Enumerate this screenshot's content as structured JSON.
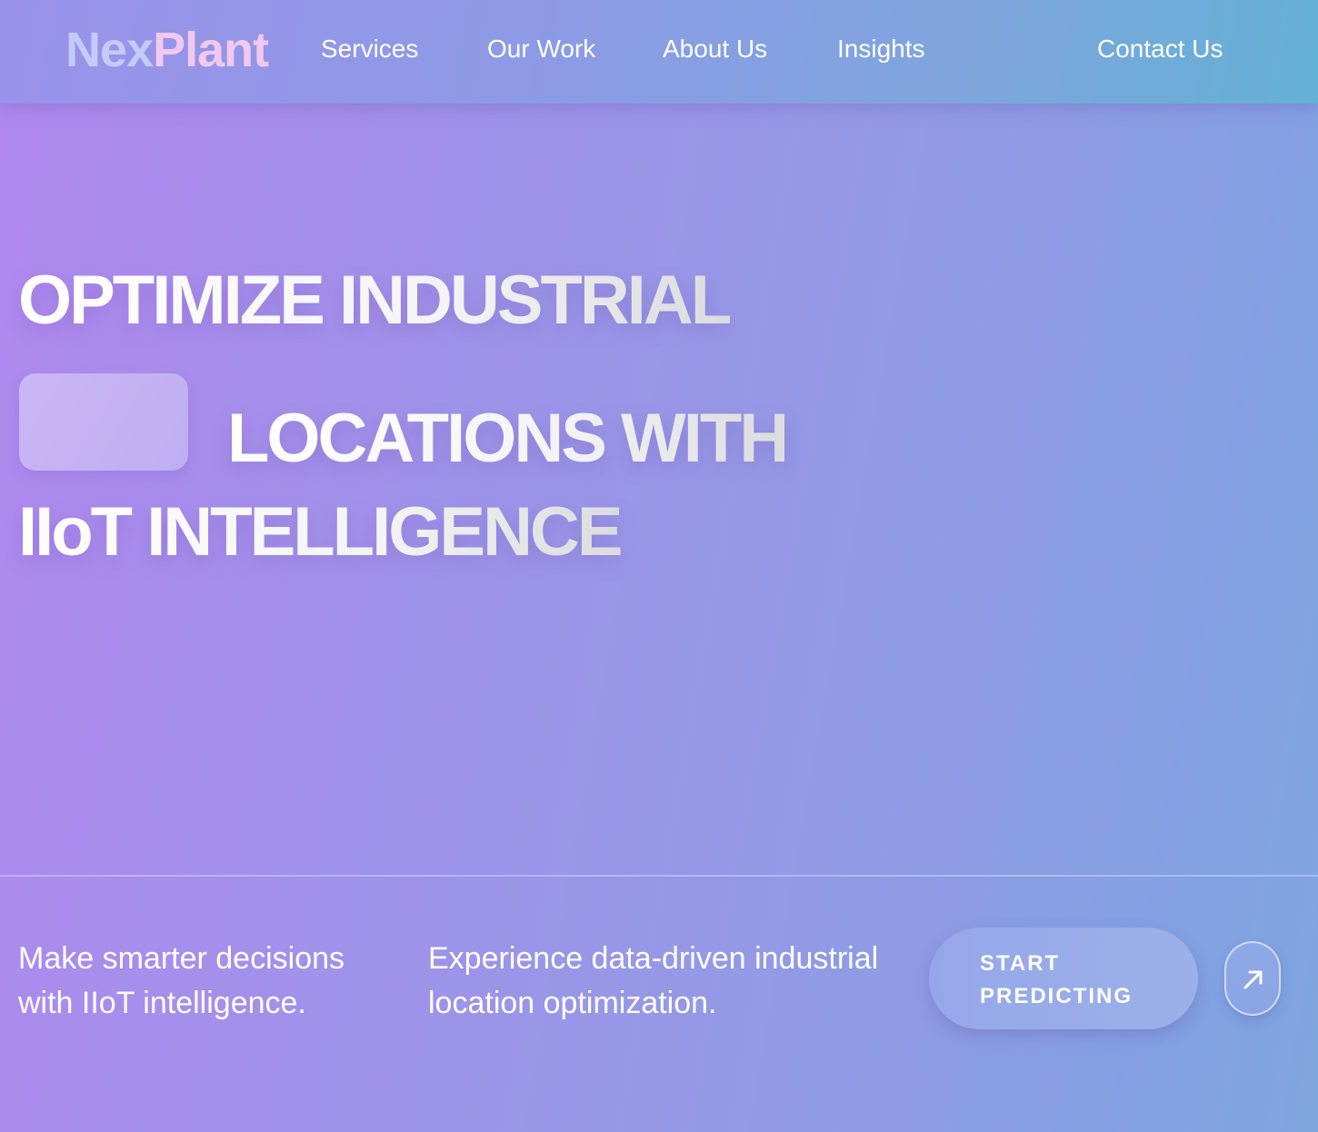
{
  "header": {
    "logo": {
      "part1": "Nex",
      "part2": "Plant"
    },
    "nav": [
      {
        "label": "Services"
      },
      {
        "label": "Our Work"
      },
      {
        "label": "About Us"
      },
      {
        "label": "Insights"
      }
    ],
    "contact_label": "Contact Us"
  },
  "hero": {
    "line1": "OPTIMIZE INDUSTRIAL",
    "line2": "LOCATIONS WITH",
    "line3": "IIoT INTELLIGENCE"
  },
  "footer": {
    "tagline_left": [
      "Make smarter decisions",
      "with IIoT intelligence."
    ],
    "tagline_right": [
      "Experience data-driven industrial",
      "location optimization."
    ],
    "cta": {
      "line1": "START",
      "line2": "PREDICTING"
    },
    "arrow_icon": "arrow-up-right-icon"
  },
  "colors": {
    "logo_nex": "#c5cbf8",
    "logo_plant": "#f3c8ee",
    "background_start": "#b188f0",
    "background_end": "#7ea6df"
  }
}
